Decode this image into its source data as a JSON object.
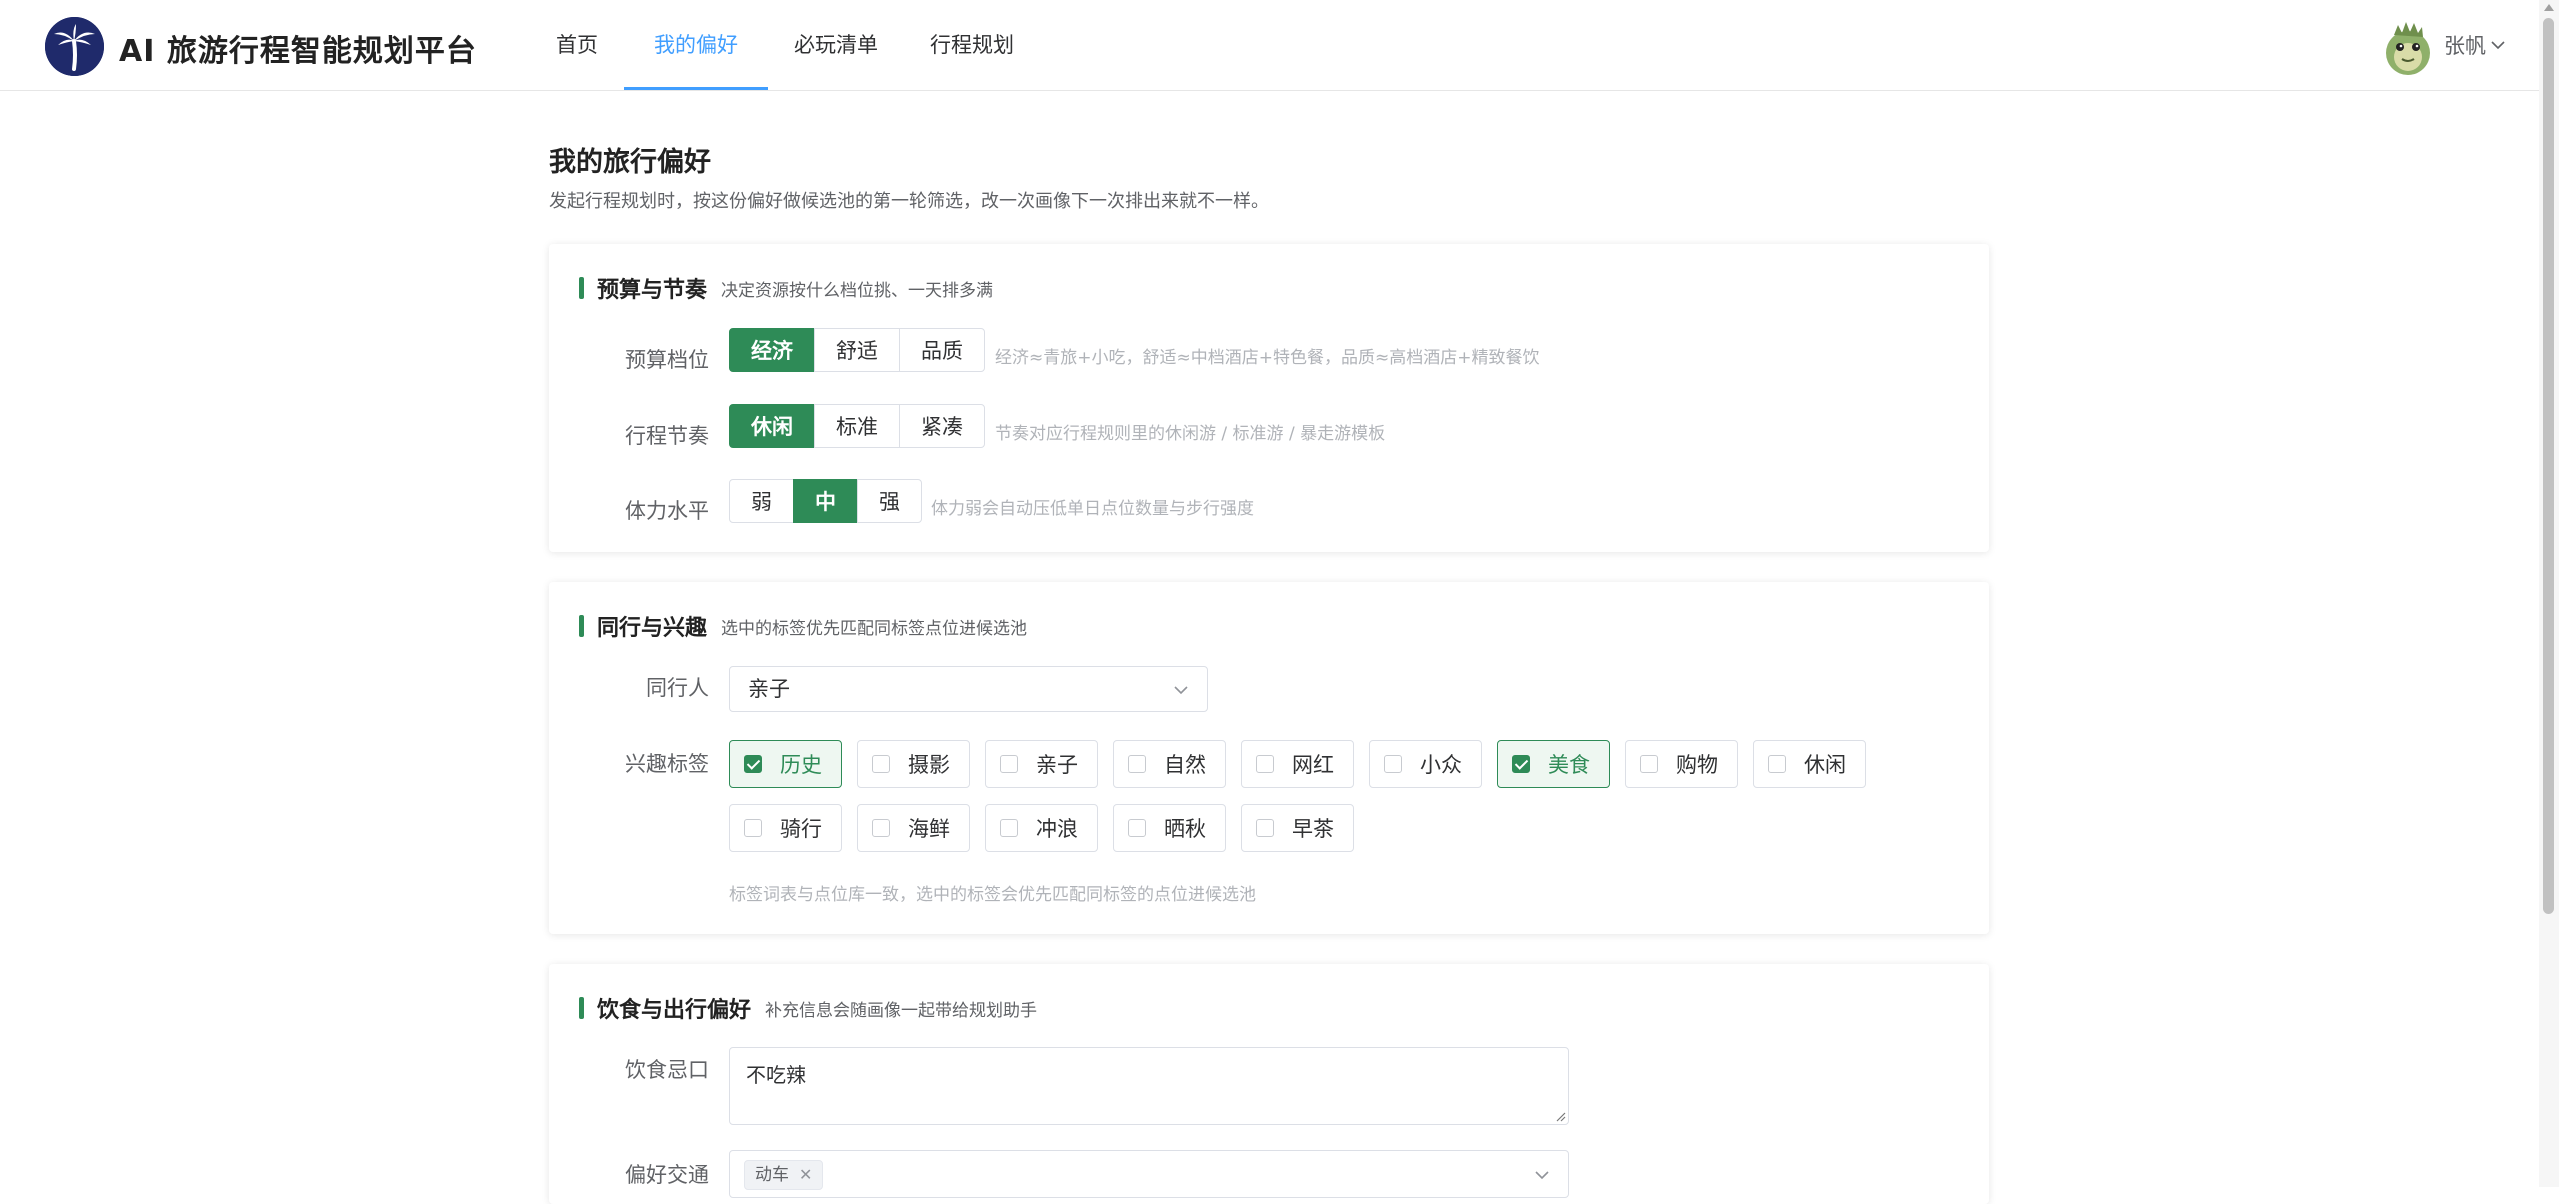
{
  "app": {
    "title": "AI 旅游行程智能规划平台",
    "logo_icon": "palm-tree-logo-icon"
  },
  "nav": {
    "items": [
      {
        "label": "首页",
        "active": false
      },
      {
        "label": "我的偏好",
        "active": true
      },
      {
        "label": "必玩清单",
        "active": false
      },
      {
        "label": "行程规划",
        "active": false
      }
    ]
  },
  "user": {
    "name": "张帆",
    "avatar_icon": "dinosaur-avatar-icon"
  },
  "page": {
    "title": "我的旅行偏好",
    "subtitle": "发起行程规划时，按这份偏好做候选池的第一轮筛选，改一次画像下一次排出来就不一样。"
  },
  "budget_card": {
    "title": "预算与节奏",
    "desc": "决定资源按什么档位挑、一天排多满",
    "budget": {
      "label": "预算档位",
      "options": [
        "经济",
        "舒适",
        "品质"
      ],
      "selected": "经济",
      "hint": "经济≈青旅+小吃，舒适≈中档酒店+特色餐，品质≈高档酒店+精致餐饮"
    },
    "pace": {
      "label": "行程节奏",
      "options": [
        "休闲",
        "标准",
        "紧凑"
      ],
      "selected": "休闲",
      "hint": "节奏对应行程规则里的休闲游 / 标准游 / 暴走游模板"
    },
    "stamina": {
      "label": "体力水平",
      "options": [
        "弱",
        "中",
        "强"
      ],
      "selected": "中",
      "hint": "体力弱会自动压低单日点位数量与步行强度"
    }
  },
  "interest_card": {
    "title": "同行与兴趣",
    "desc": "选中的标签优先匹配同标签点位进候选池",
    "companion": {
      "label": "同行人",
      "value": "亲子"
    },
    "tags": {
      "label": "兴趣标签",
      "items": [
        {
          "label": "历史",
          "checked": true
        },
        {
          "label": "摄影",
          "checked": false
        },
        {
          "label": "亲子",
          "checked": false
        },
        {
          "label": "自然",
          "checked": false
        },
        {
          "label": "网红",
          "checked": false
        },
        {
          "label": "小众",
          "checked": false
        },
        {
          "label": "美食",
          "checked": true
        },
        {
          "label": "购物",
          "checked": false
        },
        {
          "label": "休闲",
          "checked": false
        },
        {
          "label": "骑行",
          "checked": false
        },
        {
          "label": "海鲜",
          "checked": false
        },
        {
          "label": "冲浪",
          "checked": false
        },
        {
          "label": "晒秋",
          "checked": false
        },
        {
          "label": "早茶",
          "checked": false
        }
      ],
      "hint": "标签词表与点位库一致，选中的标签会优先匹配同标签的点位进候选池"
    }
  },
  "diet_card": {
    "title": "饮食与出行偏好",
    "desc": "补充信息会随画像一起带给规划助手",
    "diet": {
      "label": "饮食忌口",
      "value": "不吃辣"
    },
    "transport": {
      "label": "偏好交通",
      "chips": [
        "动车"
      ]
    }
  },
  "colors": {
    "primary_green": "#2e8b57",
    "nav_active_blue": "#409eff",
    "logo_navy": "#1f2a6b"
  }
}
